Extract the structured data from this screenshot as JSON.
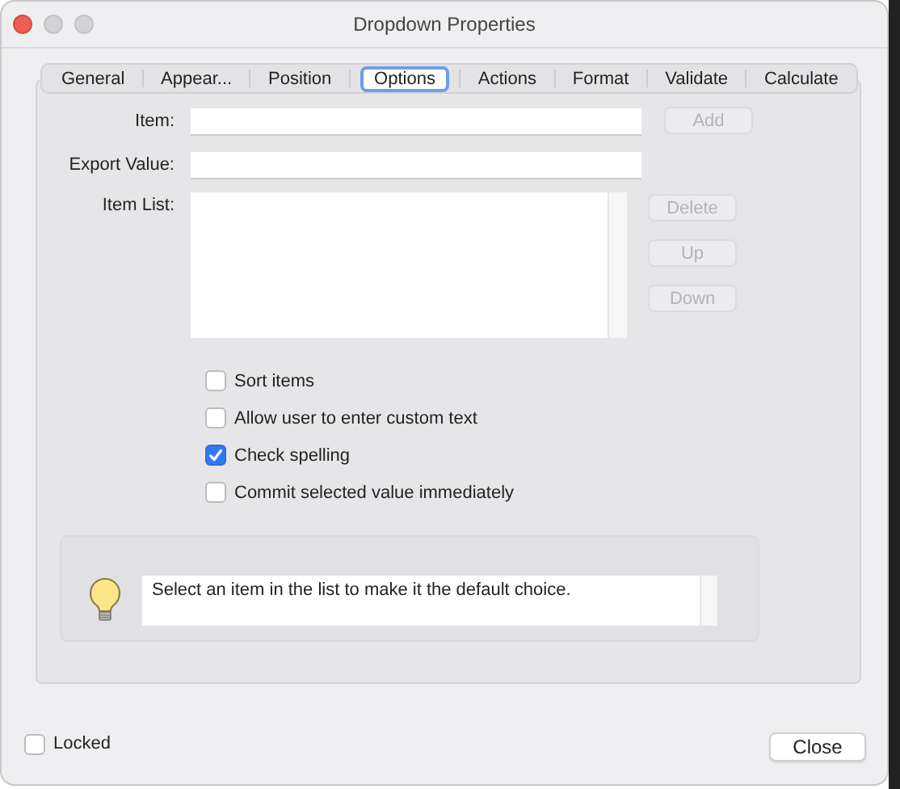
{
  "window": {
    "title": "Dropdown Properties"
  },
  "tabs": [
    {
      "label": "General",
      "selected": false
    },
    {
      "label": "Appear...",
      "selected": false
    },
    {
      "label": "Position",
      "selected": false
    },
    {
      "label": "Options",
      "selected": true
    },
    {
      "label": "Actions",
      "selected": false
    },
    {
      "label": "Format",
      "selected": false
    },
    {
      "label": "Validate",
      "selected": false
    },
    {
      "label": "Calculate",
      "selected": false
    }
  ],
  "item": {
    "label": "Item:",
    "button": {
      "label": "Add",
      "disabled": true
    }
  },
  "export_value": {
    "label": "Export Value:"
  },
  "item_list": {
    "label": "Item List:",
    "buttons": [
      {
        "label": "Delete",
        "disabled": true
      },
      {
        "label": "Up",
        "disabled": true
      },
      {
        "label": "Down",
        "disabled": true
      }
    ]
  },
  "options": [
    {
      "label": "Sort items",
      "checked": false
    },
    {
      "label": "Allow user to enter custom text",
      "checked": false
    },
    {
      "label": "Check spelling",
      "checked": true
    },
    {
      "label": "Commit selected value immediately",
      "checked": false
    }
  ],
  "hint": {
    "text": "Select an item in the list to make it the default choice."
  },
  "locked": {
    "label": "Locked",
    "checked": false
  },
  "close_button": {
    "label": "Close"
  }
}
